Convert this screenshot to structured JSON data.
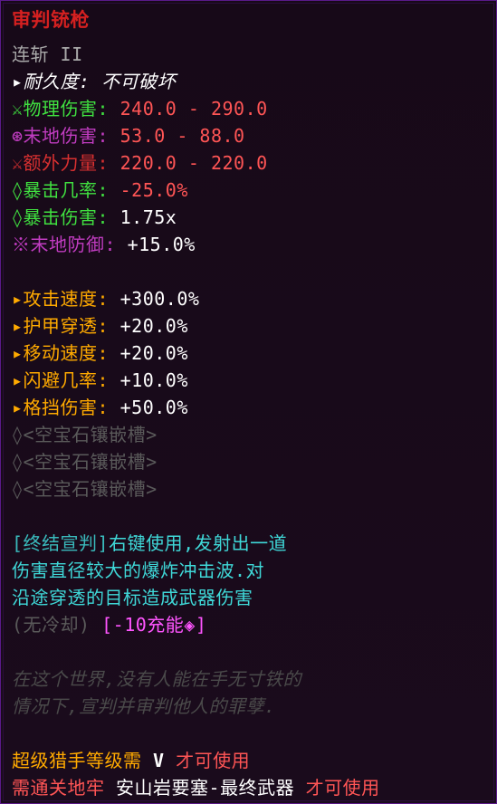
{
  "item": {
    "name": "审判铳枪",
    "reforge": "连斩 II",
    "durability_label": "▸耐久度:",
    "durability_value": " 不可破坏",
    "stats": [
      {
        "icon": "⚔",
        "label": "物理伤害:",
        "value": " 240.0 - 290.0"
      },
      {
        "icon": "⊛",
        "label": "末地伤害:",
        "value": " 53.0 - 88.0"
      },
      {
        "icon": "⚔",
        "label": "额外力量:",
        "value": " 220.0 - 220.0"
      },
      {
        "icon": "◊",
        "label": "暴击几率:",
        "value": " -25.0%"
      },
      {
        "icon": "◊",
        "label": "暴击伤害:",
        "value": " 1.75x"
      },
      {
        "icon": "※",
        "label": "末地防御:",
        "value": " +15.0%"
      }
    ],
    "bonuses": [
      {
        "label": " ▸攻击速度:",
        "value": " +300.0%"
      },
      {
        "label": " ▸护甲穿透:",
        "value": " +20.0%"
      },
      {
        "label": " ▸移动速度:",
        "value": " +20.0%"
      },
      {
        "label": " ▸闪避几率:",
        "value": " +10.0%"
      },
      {
        "label": " ▸格挡伤害:",
        "value": " +50.0%"
      }
    ],
    "gem_slots": [
      "◊<空宝石镶嵌槽>",
      "◊<空宝石镶嵌槽>",
      "◊<空宝石镶嵌槽>"
    ],
    "ability": {
      "name": "[终结宣判]",
      "line1": "右键使用,发射出一道",
      "line2": "伤害直径较大的爆炸冲击波.对",
      "line3": "沿途穿透的目标造成武器伤害",
      "cooldown": "(无冷却)",
      "cost": " [-10充能◈]"
    },
    "lore": [
      "在这个世界,没有人能在手无寸铁的",
      "情况下,宣判并审判他人的罪孽."
    ],
    "requirements": {
      "class_text": "超级猎手",
      "level_text": "等级需 ",
      "level_value": "V",
      "class_suffix": " 才可使用",
      "dungeon_prefix": "需通关地牢 ",
      "dungeon_name": "安山岩要塞-最终武器",
      "dungeon_suffix": " 才可使用"
    }
  }
}
